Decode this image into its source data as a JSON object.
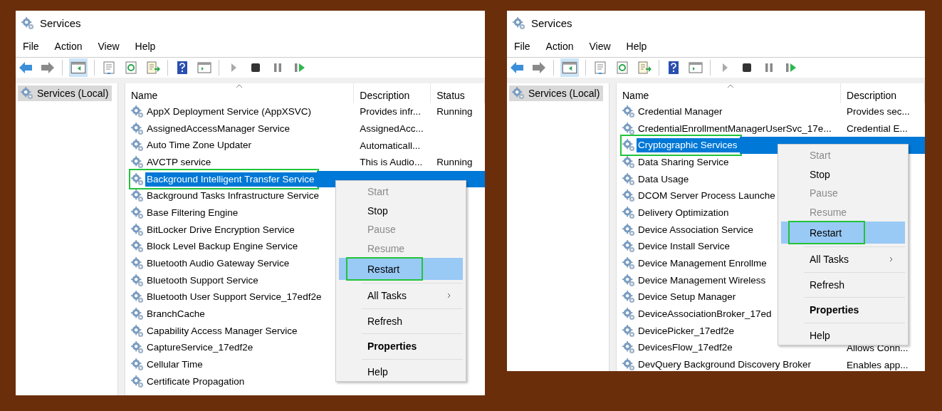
{
  "windows": [
    {
      "title": "Services",
      "menu": [
        "File",
        "Action",
        "View",
        "Help"
      ],
      "tree_item": "Services (Local)",
      "columns": [
        "Name",
        "Description",
        "Status"
      ],
      "rows": [
        {
          "name": "AppX Deployment Service (AppXSVC)",
          "description": "Provides infr...",
          "status": "Running",
          "selected": false,
          "outlined": false
        },
        {
          "name": "AssignedAccessManager Service",
          "description": "AssignedAcc...",
          "selected": false,
          "outlined": false
        },
        {
          "name": "Auto Time Zone Updater",
          "description": "Automaticall...",
          "selected": false,
          "outlined": false
        },
        {
          "name": "AVCTP service",
          "description": "This is Audio...",
          "status": "Running",
          "selected": false,
          "outlined": false
        },
        {
          "name": "Background Intelligent Transfer Service",
          "selected": true,
          "outlined": true
        },
        {
          "name": "Background Tasks Infrastructure Service",
          "selected": false,
          "outlined": false
        },
        {
          "name": "Base Filtering Engine",
          "selected": false,
          "outlined": false
        },
        {
          "name": "BitLocker Drive Encryption Service",
          "selected": false,
          "outlined": false
        },
        {
          "name": "Block Level Backup Engine Service",
          "selected": false,
          "outlined": false
        },
        {
          "name": "Bluetooth Audio Gateway Service",
          "selected": false,
          "outlined": false
        },
        {
          "name": "Bluetooth Support Service",
          "selected": false,
          "outlined": false
        },
        {
          "name": "Bluetooth User Support Service_17edf2e",
          "selected": false,
          "outlined": false
        },
        {
          "name": "BranchCache",
          "selected": false,
          "outlined": false
        },
        {
          "name": "Capability Access Manager Service",
          "selected": false,
          "outlined": false
        },
        {
          "name": "CaptureService_17edf2e",
          "selected": false,
          "outlined": false
        },
        {
          "name": "Cellular Time",
          "selected": false,
          "outlined": false
        },
        {
          "name": "Certificate Propagation",
          "selected": false,
          "outlined": false
        }
      ],
      "context_menu": [
        {
          "label": "Start",
          "kind": "disabled",
          "selected": false,
          "outlined": false,
          "divider_above": false,
          "submenu": false
        },
        {
          "label": "Stop",
          "kind": "normal",
          "selected": false,
          "outlined": false,
          "divider_above": false,
          "submenu": false
        },
        {
          "label": "Pause",
          "kind": "disabled",
          "selected": false,
          "outlined": false,
          "divider_above": false,
          "submenu": false
        },
        {
          "label": "Resume",
          "kind": "disabled",
          "selected": false,
          "outlined": false,
          "divider_above": false,
          "submenu": false
        },
        {
          "label": "Restart",
          "kind": "normal",
          "selected": true,
          "outlined": true,
          "divider_above": false,
          "submenu": false
        },
        {
          "label": "All Tasks",
          "kind": "normal",
          "selected": false,
          "outlined": false,
          "divider_above": true,
          "submenu": true
        },
        {
          "label": "Refresh",
          "kind": "normal",
          "selected": false,
          "outlined": false,
          "divider_above": true,
          "submenu": false
        },
        {
          "label": "Properties",
          "kind": "default",
          "selected": false,
          "outlined": false,
          "divider_above": true,
          "submenu": false
        },
        {
          "label": "Help",
          "kind": "normal",
          "selected": false,
          "outlined": false,
          "divider_above": true,
          "submenu": false
        }
      ]
    },
    {
      "title": "Services",
      "menu": [
        "File",
        "Action",
        "View",
        "Help"
      ],
      "tree_item": "Services (Local)",
      "columns": [
        "Name",
        "Description"
      ],
      "rows": [
        {
          "name": "Credential Manager",
          "description": "Provides sec...",
          "selected": false,
          "outlined": false
        },
        {
          "name": "CredentialEnrollmentManagerUserSvc_17e...",
          "description": "Credential E...",
          "selected": false,
          "outlined": false
        },
        {
          "name": "Cryptographic Services",
          "selected": true,
          "outlined": true
        },
        {
          "name": "Data Sharing Service",
          "selected": false,
          "outlined": false
        },
        {
          "name": "Data Usage",
          "selected": false,
          "outlined": false
        },
        {
          "name": "DCOM Server Process Launche",
          "selected": false,
          "outlined": false
        },
        {
          "name": "Delivery Optimization",
          "selected": false,
          "outlined": false
        },
        {
          "name": "Device Association Service",
          "selected": false,
          "outlined": false
        },
        {
          "name": "Device Install Service",
          "selected": false,
          "outlined": false
        },
        {
          "name": "Device Management Enrollme",
          "selected": false,
          "outlined": false
        },
        {
          "name": "Device Management Wireless",
          "selected": false,
          "outlined": false
        },
        {
          "name": "Device Setup Manager",
          "selected": false,
          "outlined": false
        },
        {
          "name": "DeviceAssociationBroker_17ed",
          "selected": false,
          "outlined": false
        },
        {
          "name": "DevicePicker_17edf2e",
          "selected": false,
          "outlined": false
        },
        {
          "name": "DevicesFlow_17edf2e",
          "description": "Allows Conn...",
          "selected": false,
          "outlined": false
        },
        {
          "name": "DevQuery Background Discovery Broker",
          "description": "Enables app...",
          "selected": false,
          "outlined": false
        }
      ],
      "context_menu": [
        {
          "label": "Start",
          "kind": "disabled",
          "selected": false,
          "outlined": false,
          "divider_above": false,
          "submenu": false
        },
        {
          "label": "Stop",
          "kind": "normal",
          "selected": false,
          "outlined": false,
          "divider_above": false,
          "submenu": false
        },
        {
          "label": "Pause",
          "kind": "disabled",
          "selected": false,
          "outlined": false,
          "divider_above": false,
          "submenu": false
        },
        {
          "label": "Resume",
          "kind": "disabled",
          "selected": false,
          "outlined": false,
          "divider_above": false,
          "submenu": false
        },
        {
          "label": "Restart",
          "kind": "normal",
          "selected": true,
          "outlined": true,
          "divider_above": false,
          "submenu": false
        },
        {
          "label": "All Tasks",
          "kind": "normal",
          "selected": false,
          "outlined": false,
          "divider_above": true,
          "submenu": true
        },
        {
          "label": "Refresh",
          "kind": "normal",
          "selected": false,
          "outlined": false,
          "divider_above": true,
          "submenu": false
        },
        {
          "label": "Properties",
          "kind": "default",
          "selected": false,
          "outlined": false,
          "divider_above": true,
          "submenu": false
        },
        {
          "label": "Help",
          "kind": "normal",
          "selected": false,
          "outlined": false,
          "divider_above": true,
          "submenu": false
        }
      ]
    }
  ]
}
